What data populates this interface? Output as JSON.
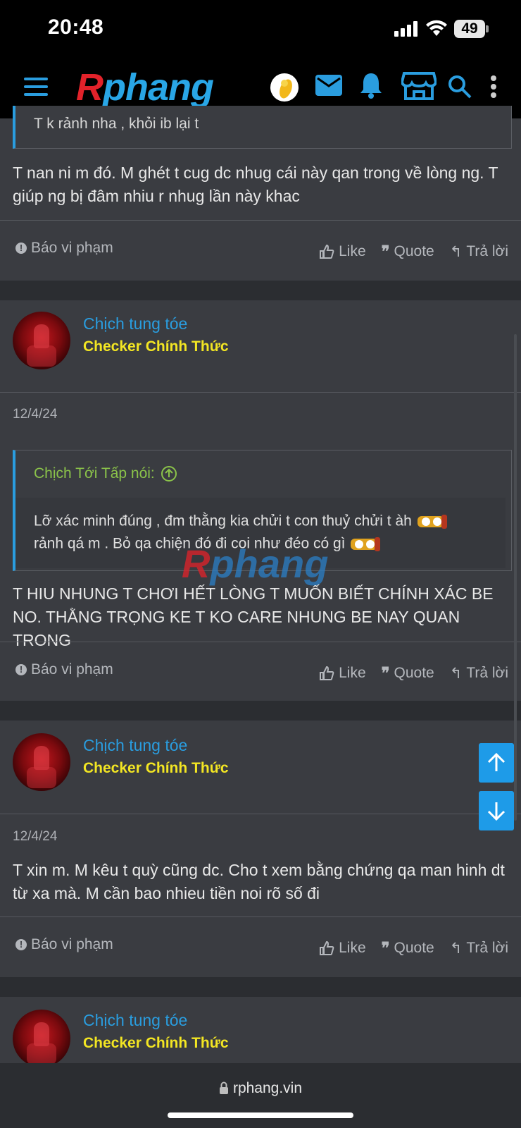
{
  "status_bar": {
    "time": "20:48",
    "battery": "49"
  },
  "header": {
    "logo_r": "R",
    "logo_rest": "phang",
    "icons": [
      "menu-icon",
      "avatar",
      "mail-icon",
      "bell-icon",
      "store-icon",
      "search-icon",
      "more-icon"
    ]
  },
  "colors": {
    "accent": "#2a9ddf",
    "role": "#f3e623",
    "quote_author": "#8bc34a",
    "header_bg": "#000000",
    "card_bg": "#3a3c41"
  },
  "posts": [
    {
      "quote_tail": "T k rảnh nha , khỏi ib lại t",
      "body": "T nan ni m đó. M ghét t cug dc nhug cái này qan trong về lòng ng. T giúp ng bị đâm nhiu r nhug lần này khac",
      "report": "Báo vi phạm",
      "like": "Like",
      "quote": "Quote",
      "reply": "Trả lời"
    },
    {
      "author": "Chịch tung tóe",
      "role": "Checker Chính Thức",
      "date": "12/4/24",
      "quote_author": "Chịch Tới Tấp nói:",
      "quote_text": "Lỡ xác minh đúng , đm thằng kia chửi t con thuỷ chửi t àh",
      "quote_text2": "rảnh qá m . Bỏ qa chiện đó đi coi như đéo có gì",
      "body": "T HIU NHUNG T CHƠI HẾT LÒNG T MUỐN BIẾT CHÍNH XÁC BE NO. THẰNG TRỌNG KE T KO CARE NHUNG BE NAY QUAN TRONG",
      "report": "Báo vi phạm",
      "like": "Like",
      "quote": "Quote",
      "reply": "Trả lời"
    },
    {
      "author": "Chịch tung tóe",
      "role": "Checker Chính Thức",
      "date": "12/4/24",
      "body": "T xin m. M kêu t quỳ cũng dc. Cho t xem bằng chứng qa man hinh dt từ xa mà. M cần bao nhieu tiền noi rõ số đi",
      "report": "Báo vi phạm",
      "like": "Like",
      "quote": "Quote",
      "reply": "Trả lời"
    },
    {
      "author": "Chịch tung tóe",
      "role": "Checker Chính Thức"
    }
  ],
  "watermark": {
    "r": "R",
    "rest": "phang"
  },
  "browser": {
    "url": "rphang.vin"
  }
}
